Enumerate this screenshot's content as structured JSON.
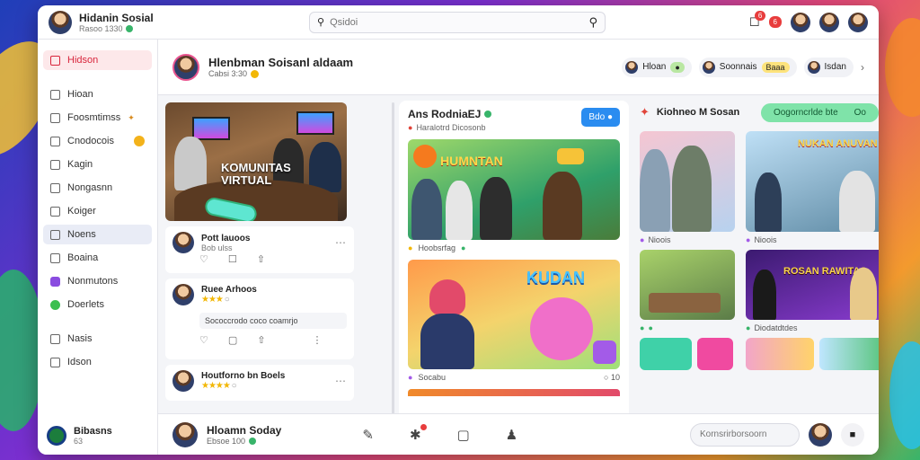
{
  "colors": {
    "accent": "#d8253c",
    "primary_blue": "#2a8cf0",
    "mint": "#7fe3a9",
    "online_green": "#38b46a"
  },
  "topbar": {
    "app_title": "Hidanin Sosial",
    "app_sub": "Rasoo 1330",
    "search_placeholder": "Qsidoi",
    "badge_1": "6",
    "badge_2": "6"
  },
  "sidebar": {
    "items": [
      {
        "label": "Hidson",
        "icon": "calendar-icon"
      },
      {
        "label": "Hioan",
        "icon": "square-icon"
      },
      {
        "label": "Foosmtimss",
        "icon": "chat-icon"
      },
      {
        "label": "Cnodocois",
        "icon": "square-icon"
      },
      {
        "label": "Kagin",
        "icon": "square-icon"
      },
      {
        "label": "Nongasnn",
        "icon": "square-icon"
      },
      {
        "label": "Koiger",
        "icon": "square-icon"
      },
      {
        "label": "Noens",
        "icon": "square-icon"
      },
      {
        "label": "Boaina",
        "icon": "square-icon"
      },
      {
        "label": "Nonmutons",
        "icon": "purple-app-icon"
      },
      {
        "label": "Doerlets",
        "icon": "green-app-icon"
      },
      {
        "label": "Nasis",
        "icon": "square-icon"
      },
      {
        "label": "Idson",
        "icon": "square-icon"
      }
    ],
    "footer_title": "Bibasns",
    "footer_sub": "63"
  },
  "profile": {
    "title": "Hlenbman Soisanl aldaam",
    "sub": "Cabsi 3:30"
  },
  "chips": [
    {
      "label": "Hloan",
      "pill": ""
    },
    {
      "label": "Soonnais",
      "pill": "Baaa"
    },
    {
      "label": "Isdan",
      "pill": ""
    }
  ],
  "feed_left": {
    "hero_caption_1": "KOMUNITAS",
    "hero_caption_2": "VIRTUAL",
    "posts": [
      {
        "name": "Pott lauoos",
        "sub": "Bob ulss"
      },
      {
        "name": "Ruee Arhoos",
        "sub": "",
        "comment": "Sococcrodo coco coamrjo"
      },
      {
        "name": "Houtforno bn Boels",
        "sub": ""
      }
    ]
  },
  "feed_center": {
    "title": "Ans RodniaEJ",
    "sub": "Haralotrd Dicosonb",
    "button": "Bdo",
    "tile1_text": "HUMNTAN",
    "tile1_caption": "Hoobsrfag",
    "tile2_text": "KUDAN",
    "tile2_caption": "Socabu",
    "tile2_right": "10"
  },
  "feed_right": {
    "title": "Kiohneo M Sosan",
    "button": "Oogorncrlde bte",
    "button_right": "Oo",
    "card1_text": "NUKAN ANUVAN",
    "card1_caption": "Nioois",
    "card2_text": "ROSAN RAWITAS",
    "card2_caption": "Diodatdtdes"
  },
  "bottombar": {
    "title": "Hloamn Soday",
    "sub": "Ebsoe 100",
    "input_placeholder": "Kornsrirborsoorn"
  }
}
